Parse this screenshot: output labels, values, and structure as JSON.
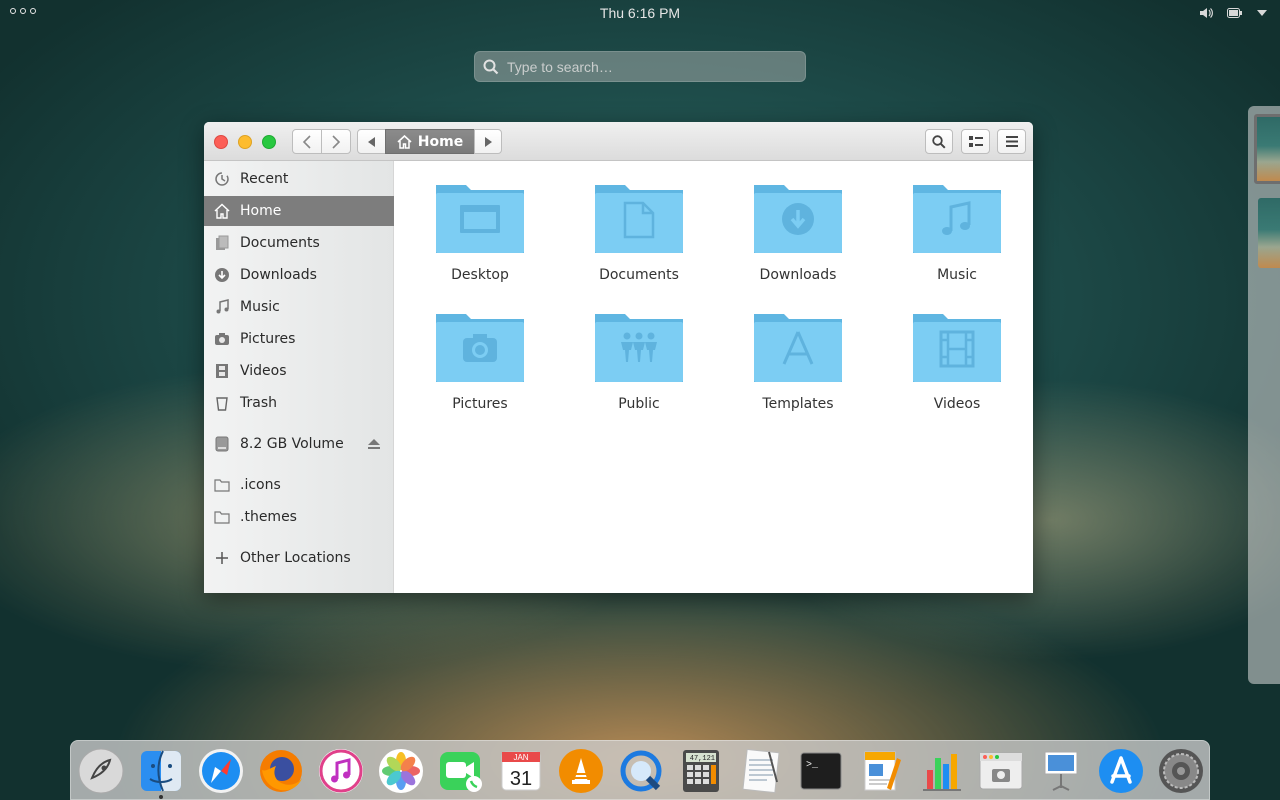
{
  "top_panel": {
    "apps_icon": "applications-dots-icon",
    "clock": "Thu  6:16 PM",
    "tray_icons": [
      "volume-icon",
      "battery-icon",
      "chevron-down-icon"
    ]
  },
  "search": {
    "placeholder": "Type to search…"
  },
  "window": {
    "toolbar": {
      "path_label": "Home",
      "path_icon": "home-icon",
      "buttons": [
        "back-arrow-icon",
        "forward-arrow-icon",
        "path-left-icon",
        "path-right-icon",
        "search-icon",
        "view-list-icon",
        "hamburger-menu-icon"
      ]
    },
    "sidebar": {
      "items": [
        {
          "label": "Recent",
          "icon": "recent-icon"
        },
        {
          "label": "Home",
          "icon": "home-icon",
          "selected": true
        },
        {
          "label": "Documents",
          "icon": "documents-icon"
        },
        {
          "label": "Downloads",
          "icon": "downloads-icon"
        },
        {
          "label": "Music",
          "icon": "music-icon"
        },
        {
          "label": "Pictures",
          "icon": "camera-icon"
        },
        {
          "label": "Videos",
          "icon": "film-icon"
        },
        {
          "label": "Trash",
          "icon": "trash-icon"
        },
        {
          "label": "8.2 GB Volume",
          "icon": "drive-icon"
        },
        {
          "label": ".icons",
          "icon": "folder-icon"
        },
        {
          "label": ".themes",
          "icon": "folder-icon"
        },
        {
          "label": "Other Locations",
          "icon": "plus-icon"
        }
      ]
    },
    "folders": [
      {
        "label": "Desktop",
        "emblem": "desktop-emblem-icon"
      },
      {
        "label": "Documents",
        "emblem": "document-emblem-icon"
      },
      {
        "label": "Downloads",
        "emblem": "download-emblem-icon"
      },
      {
        "label": "Music",
        "emblem": "music-emblem-icon"
      },
      {
        "label": "Pictures",
        "emblem": "camera-emblem-icon"
      },
      {
        "label": "Public",
        "emblem": "people-emblem-icon"
      },
      {
        "label": "Templates",
        "emblem": "templates-emblem-icon"
      },
      {
        "label": "Videos",
        "emblem": "film-emblem-icon"
      }
    ]
  },
  "dock": {
    "items": [
      {
        "name": "launcher-icon"
      },
      {
        "name": "finder-icon",
        "running": true
      },
      {
        "name": "safari-icon"
      },
      {
        "name": "firefox-icon"
      },
      {
        "name": "itunes-icon"
      },
      {
        "name": "photos-icon"
      },
      {
        "name": "facetime-icon"
      },
      {
        "name": "calendar-icon",
        "month": "JAN",
        "day": "31"
      },
      {
        "name": "vlc-icon"
      },
      {
        "name": "quicktime-icon"
      },
      {
        "name": "calculator-icon",
        "display": "47,121"
      },
      {
        "name": "text-editor-icon"
      },
      {
        "name": "terminal-icon",
        "prompt": ">_"
      },
      {
        "name": "pages-icon"
      },
      {
        "name": "numbers-icon"
      },
      {
        "name": "screenshot-icon"
      },
      {
        "name": "keynote-icon"
      },
      {
        "name": "app-store-icon"
      },
      {
        "name": "system-preferences-icon"
      }
    ]
  },
  "colors": {
    "folder_blue": "#7ccdf3",
    "folder_blue_dark": "#5fb6e2",
    "sidebar_selected": "#7d7d7d",
    "close": "#fc5f57",
    "minimize": "#fdbc2e",
    "maximize": "#28c840"
  }
}
